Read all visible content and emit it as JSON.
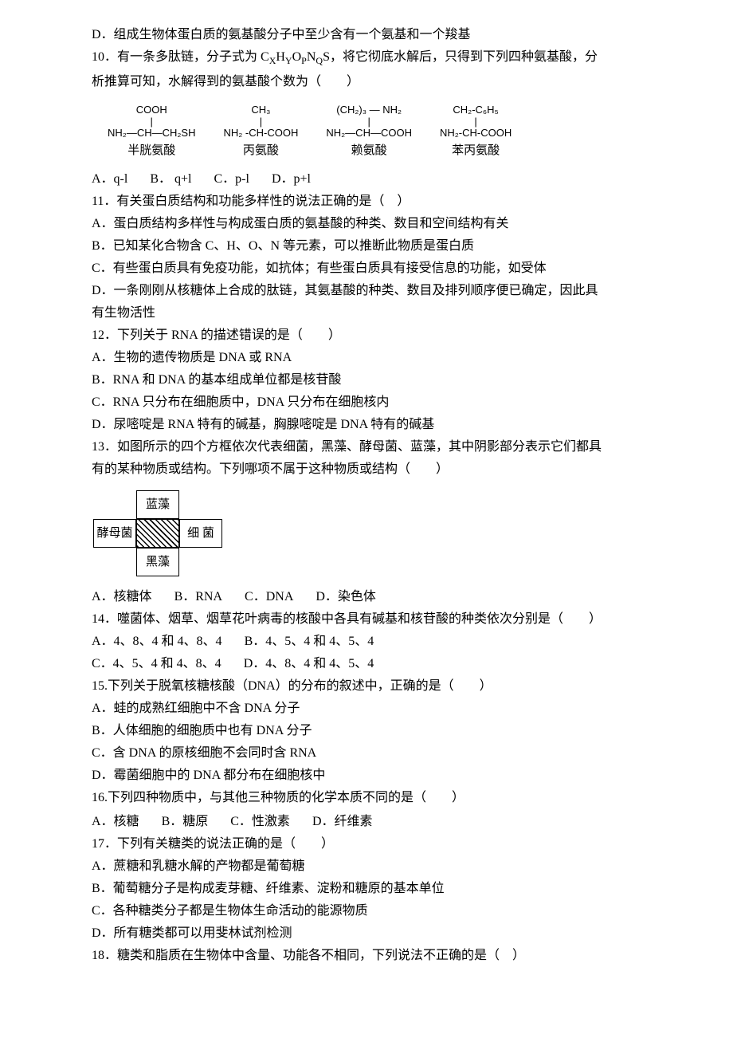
{
  "q9": {
    "d": "D．组成生物体蛋白质的氨基酸分子中至少含有一个氨基和一个羧基"
  },
  "q10": {
    "stem1": "10．有一条多肽链，分子式为 C",
    "x": "X",
    "h": "H",
    "y": "Y",
    "o": "O",
    "p": "P",
    "n": "N",
    "q": "Q",
    "s": "S",
    "stem2": "，将它彻底水解后，只得到下列四种氨基酸，分",
    "stem3": "析推算可知，水解得到的氨基酸个数为（　　）",
    "c1": {
      "l1": "COOH",
      "l2": "|",
      "l3": "NH₂—CH—CH₂SH",
      "name": "半胱氨酸"
    },
    "c2": {
      "l1": "CH₃",
      "l2": "|",
      "l3": "NH₂ -CH-COOH",
      "name": "丙氨酸"
    },
    "c3": {
      "l1": "(CH₂)₃ — NH₂",
      "l2": "|",
      "l3": "NH₂—CH—COOH",
      "name": "赖氨酸"
    },
    "c4": {
      "l1": "CH₂-C₆H₅",
      "l2": "|",
      "l3": "NH₂-CH-COOH",
      "name": "苯丙氨酸"
    },
    "a": "A．q-l",
    "b": "B．  q+l",
    "c": "C．p-l",
    "d": "D．p+l"
  },
  "q11": {
    "stem": "11．有关蛋白质结构和功能多样性的说法正确的是（　）",
    "a": "A．蛋白质结构多样性与构成蛋白质的氨基酸的种类、数目和空间结构有关",
    "b": "B．已知某化合物含 C、H、O、N 等元素，可以推断此物质是蛋白质",
    "c": "C．有些蛋白质具有免疫功能，如抗体；有些蛋白质具有接受信息的功能，如受体",
    "d1": "D．一条刚刚从核糖体上合成的肽链，其氨基酸的种类、数目及排列顺序便已确定，因此具",
    "d2": "有生物活性"
  },
  "q12": {
    "stem": "12．下列关于 RNA 的描述错误的是（　　）",
    "a": "A．生物的遗传物质是 DNA 或 RNA",
    "b": "B．RNA 和 DNA 的基本组成单位都是核苷酸",
    "c": "C．RNA 只分布在细胞质中，DNA 只分布在细胞核内",
    "d": "D．尿嘧啶是 RNA 特有的碱基，胸腺嘧啶是 DNA 特有的碱基"
  },
  "q13": {
    "stem1": "13．如图所示的四个方框依次代表细菌，黑藻、酵母菌、蓝藻，其中阴影部分表示它们都具",
    "stem2": "有的某种物质或结构。下列哪项不属于这种物质或结构（　　）",
    "g": {
      "top": "蓝藻",
      "left": "酵母菌",
      "right": "细 菌",
      "bottom": "黑藻"
    },
    "a": "A．核糖体",
    "b": "B．RNA",
    "c": "C．DNA",
    "d": "D．染色体"
  },
  "q14": {
    "stem": "14．噬菌体、烟草、烟草花叶病毒的核酸中各具有碱基和核苷酸的种类依次分别是（　　）",
    "a": "A．4、8、4 和 4、8、4",
    "b": "B．4、5、4 和 4、5、4",
    "c": "C．4、5、4 和 4、8、4",
    "d": "D．4、8、4 和 4、5、4"
  },
  "q15": {
    "stem": "15.下列关于脱氧核糖核酸（DNA）的分布的叙述中，正确的是（　　）",
    "a": "A．蛙的成熟红细胞中不含 DNA 分子",
    "b": "B．人体细胞的细胞质中也有 DNA 分子",
    "c": "C．含 DNA 的原核细胞不会同时含 RNA",
    "d": "D．霉菌细胞中的 DNA 都分布在细胞核中"
  },
  "q16": {
    "stem": "16.下列四种物质中，与其他三种物质的化学本质不同的是（　　）",
    "a": "A．核糖",
    "b": "B．糖原",
    "c": "C．性激素",
    "d": "D．纤维素"
  },
  "q17": {
    "stem": "17．下列有关糖类的说法正确的是（　　）",
    "a": "A．蔗糖和乳糖水解的产物都是葡萄糖",
    "b": "B．葡萄糖分子是构成麦芽糖、纤维素、淀粉和糖原的基本单位",
    "c": "C．各种糖类分子都是生物体生命活动的能源物质",
    "d": "D．所有糖类都可以用斐林试剂检测"
  },
  "q18": {
    "stem": "18．糖类和脂质在生物体中含量、功能各不相同，下列说法不正确的是（　）"
  }
}
